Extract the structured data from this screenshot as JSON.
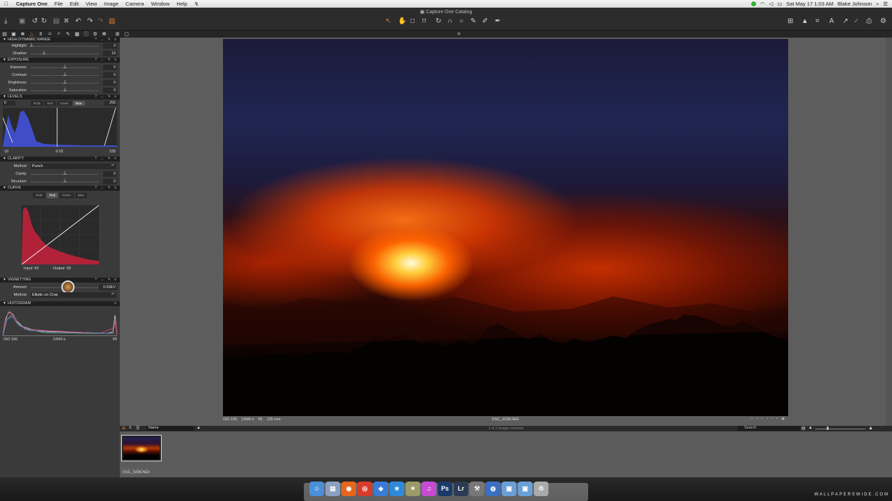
{
  "menubar": {
    "apple": "",
    "items": [
      "Capture One",
      "File",
      "Edit",
      "View",
      "Image",
      "Camera",
      "Window",
      "Help"
    ],
    "clock": "Sat May 17  1:03 AM",
    "user": "Blake Johnson"
  },
  "window": {
    "title": "Capture One Catalog"
  },
  "panels": {
    "hdr": {
      "title": "HIGH DYNAMIC RANGE",
      "highlight_label": "Highlight",
      "highlight_value": "0",
      "highlight_level": 0,
      "shadow_label": "Shadow",
      "shadow_value": "19",
      "shadow_level": 19
    },
    "exposure": {
      "title": "EXPOSURE",
      "rows": [
        {
          "label": "Exposure",
          "value": "0"
        },
        {
          "label": "Contrast",
          "value": "0"
        },
        {
          "label": "Brightness",
          "value": "0"
        },
        {
          "label": "Saturation",
          "value": "0"
        }
      ]
    },
    "levels": {
      "title": "LEVELS",
      "tabs": [
        "RGB",
        "Red",
        "Green",
        "Blue"
      ],
      "active_tab": "Blue",
      "top_left": "0",
      "top_right": "255",
      "bottom_left": "19",
      "bottom_mid": "0.02",
      "bottom_right": "235"
    },
    "clarity": {
      "title": "CLARITY",
      "method_label": "Method",
      "method_value": "Punch",
      "clarity_label": "Clarity",
      "clarity_value": "0",
      "structure_label": "Structure",
      "structure_value": "0"
    },
    "curve": {
      "title": "CURVE",
      "tabs": [
        "RGB",
        "Red",
        "Green",
        "Blue"
      ],
      "active_tab": "Red",
      "input": "Input: 93",
      "output": "Output: 93"
    },
    "vignetting": {
      "title": "VIGNETTING",
      "amount_label": "Amount",
      "amount_value": "0.69EV",
      "method_label": "Method",
      "method_value": "Elliptic on Crop"
    },
    "histogram": {
      "title": "HISTOGRAM",
      "iso": "ISO 100",
      "shutter": "1/640 s",
      "aperture": "f/5"
    }
  },
  "viewer": {
    "meta_left": "ISO 100    1/640 s    f/5    135 mm",
    "filename": "DSC_9298.NEF"
  },
  "browser": {
    "sort": "Name",
    "count": "1 of 1 images selected",
    "search_placeholder": "Search",
    "thumb_name": "DSC_9298.NEF"
  },
  "dock": {
    "apps": [
      {
        "name": "finder",
        "glyph": "☺",
        "color": "#4a8fd8"
      },
      {
        "name": "preview",
        "glyph": "▤",
        "color": "#8aa0c0"
      },
      {
        "name": "firefox",
        "glyph": "◉",
        "color": "#e8651c"
      },
      {
        "name": "chrome",
        "glyph": "◎",
        "color": "#d93b2b"
      },
      {
        "name": "safari",
        "glyph": "◈",
        "color": "#3a7bd5"
      },
      {
        "name": "app-store",
        "glyph": "★",
        "color": "#2e8ad8"
      },
      {
        "name": "star",
        "glyph": "✶",
        "color": "#9a9a6a"
      },
      {
        "name": "itunes",
        "glyph": "♫",
        "color": "#c54bd1"
      },
      {
        "name": "photoshop",
        "glyph": "Ps",
        "color": "#1b3a6b"
      },
      {
        "name": "lightroom",
        "glyph": "Lr",
        "color": "#2b3b55"
      },
      {
        "name": "tools",
        "glyph": "⚒",
        "color": "#777"
      },
      {
        "name": "globe",
        "glyph": "◍",
        "color": "#3a6fc2"
      },
      {
        "name": "folder",
        "glyph": "▣",
        "color": "#6aa0d8"
      },
      {
        "name": "downloads",
        "glyph": "▣",
        "color": "#6aa0d8"
      },
      {
        "name": "trash",
        "glyph": "♲",
        "color": "#aaa"
      }
    ]
  },
  "watermark": "WALLPAPERSWIDE.COM"
}
